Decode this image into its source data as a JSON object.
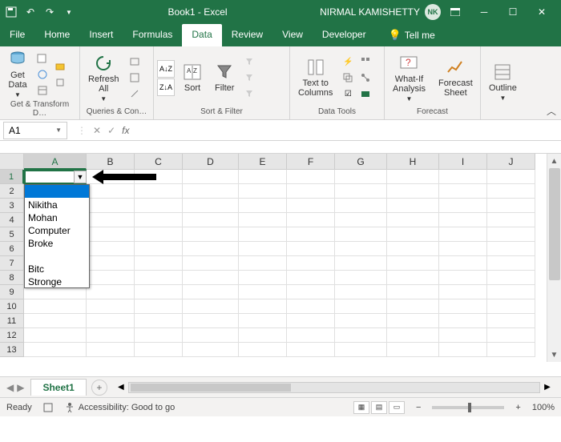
{
  "titlebar": {
    "doc_title": "Book1 - Excel",
    "user_name": "NIRMAL KAMISHETTY",
    "user_initials": "NK"
  },
  "tabs": {
    "file": "File",
    "home": "Home",
    "insert": "Insert",
    "formulas": "Formulas",
    "data": "Data",
    "review": "Review",
    "view": "View",
    "developer": "Developer",
    "tellme": "Tell me"
  },
  "ribbon": {
    "get_data": "Get\nData",
    "group_get_transform": "Get & Transform D…",
    "refresh_all": "Refresh\nAll",
    "group_queries": "Queries & Con…",
    "az": "A↓Z",
    "za": "Z↓A",
    "sort_icon": "A|Z",
    "sort_label": "Sort",
    "filter_label": "Filter",
    "group_sort_filter": "Sort & Filter",
    "text_to_columns": "Text to\nColumns",
    "group_data_tools": "Data Tools",
    "what_if": "What-If\nAnalysis",
    "forecast_sheet": "Forecast\nSheet",
    "group_forecast": "Forecast",
    "outline": "Outline"
  },
  "formula_bar": {
    "namebox": "A1",
    "fx": "fx",
    "formula": ""
  },
  "grid": {
    "columns": [
      "A",
      "B",
      "C",
      "D",
      "E",
      "F",
      "G",
      "H",
      "I",
      "J"
    ],
    "row_numbers": [
      "1",
      "2",
      "3",
      "4",
      "5",
      "6",
      "7",
      "8",
      "9",
      "10",
      "11",
      "12",
      "13"
    ]
  },
  "cells": {
    "A7": "Bitc",
    "A8": "Stronge"
  },
  "dropdown": {
    "items": [
      "",
      "Nikitha",
      "Mohan",
      "Computer",
      "Broke",
      "",
      "Bitc",
      "Stronge"
    ],
    "selected_index": 0
  },
  "sheet_tabs": {
    "active": "Sheet1"
  },
  "status": {
    "ready": "Ready",
    "accessibility": "Accessibility: Good to go",
    "zoom": "100%"
  }
}
